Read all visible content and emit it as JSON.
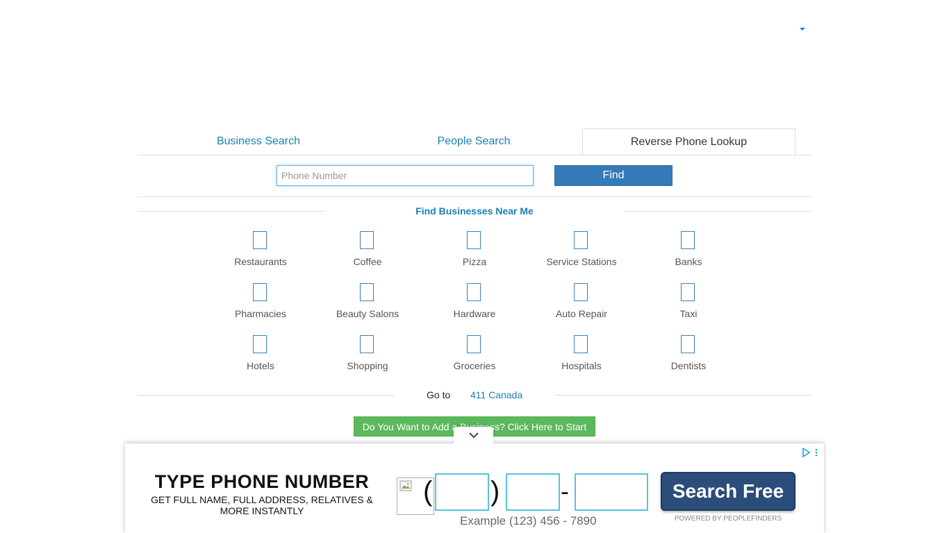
{
  "header": {
    "menu_caret_icon": "caret-down-icon"
  },
  "tabs": [
    {
      "label": "Business Search",
      "active": false
    },
    {
      "label": "People Search",
      "active": false
    },
    {
      "label": "Reverse Phone Lookup",
      "active": true
    }
  ],
  "search": {
    "placeholder": "Phone Number",
    "value": "",
    "find_label": "Find"
  },
  "near_me": {
    "title": "Find Businesses Near Me",
    "categories": [
      "Restaurants",
      "Coffee",
      "Pizza",
      "Service Stations",
      "Banks",
      "Pharmacies",
      "Beauty Salons",
      "Hardware",
      "Auto Repair",
      "Taxi",
      "Hotels",
      "Shopping",
      "Groceries",
      "Hospitals",
      "Dentists"
    ]
  },
  "goto": {
    "label": "Go to",
    "link": "411 Canada"
  },
  "add_business_label": "Do You Want to Add a Business? Click Here to Start",
  "ad": {
    "headline": "TYPE PHONE NUMBER",
    "subline": "GET FULL NAME, FULL ADDRESS, RELATIVES & MORE INSTANTLY",
    "open_paren": "(",
    "close_paren": ")",
    "dash": "-",
    "example": "Example (123) 456 - 7890",
    "button_label": "Search Free",
    "powered_by": "POWERED BY PEOPLEFINDERS",
    "accent_color": "#55c3dc",
    "button_color": "#2b4d7a"
  },
  "colors": {
    "link": "#1a7fb5",
    "primary_button": "#337ab7",
    "success_button": "#5cb85c"
  }
}
